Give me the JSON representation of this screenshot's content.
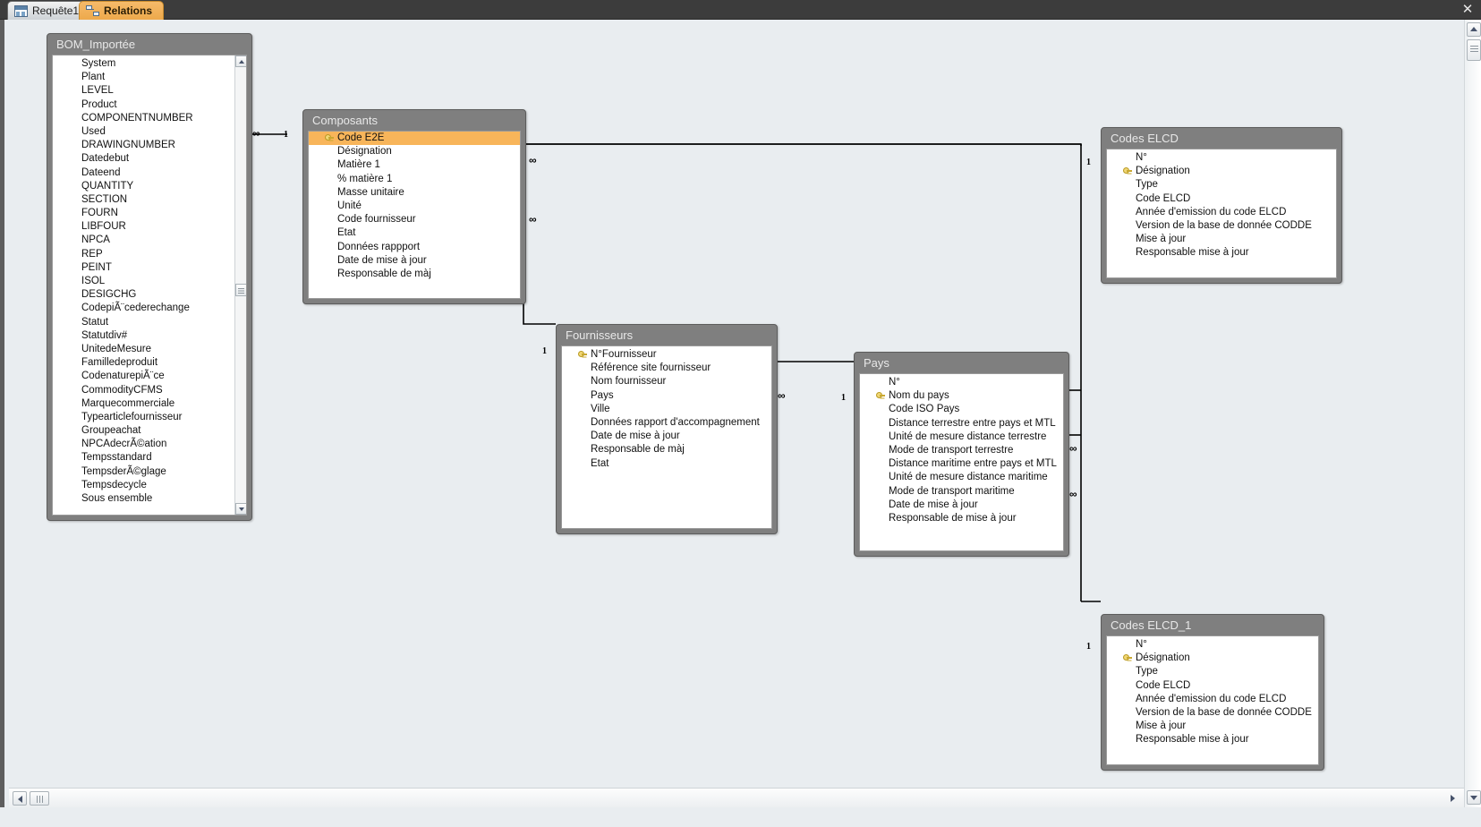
{
  "window": {
    "close_label": "✕"
  },
  "tabs": [
    {
      "label": "Requête1",
      "icon": "query-icon",
      "active": false
    },
    {
      "label": "Relations",
      "icon": "relations-icon",
      "active": true
    }
  ],
  "colors": {
    "accent": "#f8b55a",
    "tab_active": "#eda94b",
    "table_header": "#7f7f7f",
    "canvas": "#e9edf0",
    "chrome": "#3c3c3c"
  },
  "tables": [
    {
      "name": "BOM_Importee",
      "title": "BOM_Importée",
      "has_scrollbar": true,
      "fields": [
        {
          "label": "System",
          "pk": false
        },
        {
          "label": "Plant",
          "pk": false
        },
        {
          "label": "LEVEL",
          "pk": false
        },
        {
          "label": "Product",
          "pk": false
        },
        {
          "label": "COMPONENTNUMBER",
          "pk": false
        },
        {
          "label": "Used",
          "pk": false
        },
        {
          "label": "DRAWINGNUMBER",
          "pk": false
        },
        {
          "label": "Datedebut",
          "pk": false
        },
        {
          "label": "Dateend",
          "pk": false
        },
        {
          "label": "QUANTITY",
          "pk": false
        },
        {
          "label": "SECTION",
          "pk": false
        },
        {
          "label": "FOURN",
          "pk": false
        },
        {
          "label": "LIBFOUR",
          "pk": false
        },
        {
          "label": "NPCA",
          "pk": false
        },
        {
          "label": "REP",
          "pk": false
        },
        {
          "label": "PEINT",
          "pk": false
        },
        {
          "label": "ISOL",
          "pk": false
        },
        {
          "label": "DESIGCHG",
          "pk": false
        },
        {
          "label": "CodepiÃ¨cederechange",
          "pk": false
        },
        {
          "label": "Statut",
          "pk": false
        },
        {
          "label": "Statutdiv#",
          "pk": false
        },
        {
          "label": "UnitedeMesure",
          "pk": false
        },
        {
          "label": "Familledeproduit",
          "pk": false
        },
        {
          "label": "CodenaturepiÃ¨ce",
          "pk": false
        },
        {
          "label": "CommodityCFMS",
          "pk": false
        },
        {
          "label": "Marquecommerciale",
          "pk": false
        },
        {
          "label": "Typearticlefournisseur",
          "pk": false
        },
        {
          "label": "Groupeachat",
          "pk": false
        },
        {
          "label": "NPCAdecrÃ©ation",
          "pk": false
        },
        {
          "label": "Tempsstandard",
          "pk": false
        },
        {
          "label": "TempsderÃ©glage",
          "pk": false
        },
        {
          "label": "Tempsdecycle",
          "pk": false
        },
        {
          "label": "Sous ensemble",
          "pk": false
        }
      ]
    },
    {
      "name": "Composants",
      "title": "Composants",
      "has_scrollbar": false,
      "fields": [
        {
          "label": "Code E2E",
          "pk": true,
          "selected": true
        },
        {
          "label": "Désignation",
          "pk": false
        },
        {
          "label": "Matière 1",
          "pk": false
        },
        {
          "label": "% matière 1",
          "pk": false
        },
        {
          "label": "Masse unitaire",
          "pk": false
        },
        {
          "label": "Unité",
          "pk": false
        },
        {
          "label": "Code fournisseur",
          "pk": false
        },
        {
          "label": "Etat",
          "pk": false
        },
        {
          "label": "Données rappport",
          "pk": false
        },
        {
          "label": "Date de mise à jour",
          "pk": false
        },
        {
          "label": "Responsable de màj",
          "pk": false
        }
      ]
    },
    {
      "name": "Fournisseurs",
      "title": "Fournisseurs",
      "has_scrollbar": false,
      "fields": [
        {
          "label": "N°Fournisseur",
          "pk": true
        },
        {
          "label": "Référence site fournisseur",
          "pk": false
        },
        {
          "label": "Nom fournisseur",
          "pk": false
        },
        {
          "label": "Pays",
          "pk": false
        },
        {
          "label": "Ville",
          "pk": false
        },
        {
          "label": "Données rapport d'accompagnement",
          "pk": false
        },
        {
          "label": "Date de mise à jour",
          "pk": false
        },
        {
          "label": "Responsable de màj",
          "pk": false
        },
        {
          "label": "Etat",
          "pk": false
        }
      ]
    },
    {
      "name": "Pays",
      "title": "Pays",
      "has_scrollbar": false,
      "fields": [
        {
          "label": "N°",
          "pk": false
        },
        {
          "label": "Nom du pays",
          "pk": true
        },
        {
          "label": "Code ISO Pays",
          "pk": false
        },
        {
          "label": "Distance terrestre entre pays et MTL",
          "pk": false
        },
        {
          "label": "Unité de mesure distance terrestre",
          "pk": false
        },
        {
          "label": "Mode de transport terrestre",
          "pk": false
        },
        {
          "label": "Distance maritime entre pays et MTL",
          "pk": false
        },
        {
          "label": "Unité de mesure distance maritime",
          "pk": false
        },
        {
          "label": "Mode de transport maritime",
          "pk": false
        },
        {
          "label": "Date de mise à jour",
          "pk": false
        },
        {
          "label": "Responsable de mise à jour",
          "pk": false
        }
      ]
    },
    {
      "name": "CodesELCD",
      "title": "Codes ELCD",
      "has_scrollbar": false,
      "fields": [
        {
          "label": "N°",
          "pk": false
        },
        {
          "label": "Désignation",
          "pk": true
        },
        {
          "label": "Type",
          "pk": false
        },
        {
          "label": "Code ELCD",
          "pk": false
        },
        {
          "label": "Année d'emission du code ELCD",
          "pk": false
        },
        {
          "label": "Version de la base de donnée CODDE",
          "pk": false
        },
        {
          "label": "Mise à jour",
          "pk": false
        },
        {
          "label": "Responsable mise à jour",
          "pk": false
        }
      ]
    },
    {
      "name": "CodesELCD1",
      "title": "Codes ELCD_1",
      "has_scrollbar": false,
      "fields": [
        {
          "label": "N°",
          "pk": false
        },
        {
          "label": "Désignation",
          "pk": true
        },
        {
          "label": "Type",
          "pk": false
        },
        {
          "label": "Code ELCD",
          "pk": false
        },
        {
          "label": "Année d'emission du code ELCD",
          "pk": false
        },
        {
          "label": "Version de la base de donnée CODDE",
          "pk": false
        },
        {
          "label": "Mise à jour",
          "pk": false
        },
        {
          "label": "Responsable mise à jour",
          "pk": false
        }
      ]
    }
  ],
  "relationships": [
    {
      "name": "bom-composants",
      "left_label": "∞",
      "right_label": "1"
    },
    {
      "name": "composants-codeselcd",
      "left_label": "∞",
      "right_label": "1"
    },
    {
      "name": "composants-fournisseurs",
      "left_label": "∞",
      "right_label": "1"
    },
    {
      "name": "fournisseurs-pays",
      "left_label": "∞",
      "right_label": "1"
    },
    {
      "name": "pays-codeselcd",
      "left_label": "∞",
      "right_label": "1"
    },
    {
      "name": "pays-codeselcd1",
      "left_label": "∞",
      "right_label": "1"
    }
  ]
}
